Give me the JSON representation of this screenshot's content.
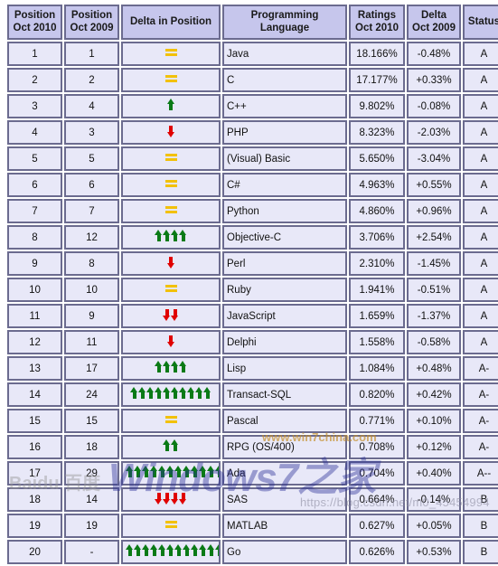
{
  "table": {
    "columns": [
      {
        "key": "pos2010",
        "label_line1": "Position",
        "label_line2": "Oct 2010"
      },
      {
        "key": "pos2009",
        "label_line1": "Position",
        "label_line2": "Oct 2009"
      },
      {
        "key": "delta",
        "label_line1": "Delta in Position",
        "label_line2": ""
      },
      {
        "key": "language",
        "label_line1": "Programming Language",
        "label_line2": ""
      },
      {
        "key": "ratings",
        "label_line1": "Ratings",
        "label_line2": "Oct 2010"
      },
      {
        "key": "deltaratings",
        "label_line1": "Delta",
        "label_line2": "Oct 2009"
      },
      {
        "key": "status",
        "label_line1": "Status",
        "label_line2": ""
      }
    ],
    "rows": [
      {
        "pos2010": "1",
        "pos2009": "1",
        "delta_dir": "equal",
        "delta_count": 1,
        "language": "Java",
        "ratings": "18.166%",
        "deltaratings": "-0.48%",
        "status": "A"
      },
      {
        "pos2010": "2",
        "pos2009": "2",
        "delta_dir": "equal",
        "delta_count": 1,
        "language": "C",
        "ratings": "17.177%",
        "deltaratings": "+0.33%",
        "status": "A"
      },
      {
        "pos2010": "3",
        "pos2009": "4",
        "delta_dir": "up",
        "delta_count": 1,
        "language": "C++",
        "ratings": "9.802%",
        "deltaratings": "-0.08%",
        "status": "A"
      },
      {
        "pos2010": "4",
        "pos2009": "3",
        "delta_dir": "down",
        "delta_count": 1,
        "language": "PHP",
        "ratings": "8.323%",
        "deltaratings": "-2.03%",
        "status": "A"
      },
      {
        "pos2010": "5",
        "pos2009": "5",
        "delta_dir": "equal",
        "delta_count": 1,
        "language": "(Visual) Basic",
        "ratings": "5.650%",
        "deltaratings": "-3.04%",
        "status": "A"
      },
      {
        "pos2010": "6",
        "pos2009": "6",
        "delta_dir": "equal",
        "delta_count": 1,
        "language": "C#",
        "ratings": "4.963%",
        "deltaratings": "+0.55%",
        "status": "A"
      },
      {
        "pos2010": "7",
        "pos2009": "7",
        "delta_dir": "equal",
        "delta_count": 1,
        "language": "Python",
        "ratings": "4.860%",
        "deltaratings": "+0.96%",
        "status": "A"
      },
      {
        "pos2010": "8",
        "pos2009": "12",
        "delta_dir": "up",
        "delta_count": 4,
        "language": "Objective-C",
        "ratings": "3.706%",
        "deltaratings": "+2.54%",
        "status": "A"
      },
      {
        "pos2010": "9",
        "pos2009": "8",
        "delta_dir": "down",
        "delta_count": 1,
        "language": "Perl",
        "ratings": "2.310%",
        "deltaratings": "-1.45%",
        "status": "A"
      },
      {
        "pos2010": "10",
        "pos2009": "10",
        "delta_dir": "equal",
        "delta_count": 1,
        "language": "Ruby",
        "ratings": "1.941%",
        "deltaratings": "-0.51%",
        "status": "A"
      },
      {
        "pos2010": "11",
        "pos2009": "9",
        "delta_dir": "down",
        "delta_count": 2,
        "language": "JavaScript",
        "ratings": "1.659%",
        "deltaratings": "-1.37%",
        "status": "A"
      },
      {
        "pos2010": "12",
        "pos2009": "11",
        "delta_dir": "down",
        "delta_count": 1,
        "language": "Delphi",
        "ratings": "1.558%",
        "deltaratings": "-0.58%",
        "status": "A"
      },
      {
        "pos2010": "13",
        "pos2009": "17",
        "delta_dir": "up",
        "delta_count": 4,
        "language": "Lisp",
        "ratings": "1.084%",
        "deltaratings": "+0.48%",
        "status": "A-"
      },
      {
        "pos2010": "14",
        "pos2009": "24",
        "delta_dir": "up",
        "delta_count": 10,
        "language": "Transact-SQL",
        "ratings": "0.820%",
        "deltaratings": "+0.42%",
        "status": "A-"
      },
      {
        "pos2010": "15",
        "pos2009": "15",
        "delta_dir": "equal",
        "delta_count": 1,
        "language": "Pascal",
        "ratings": "0.771%",
        "deltaratings": "+0.10%",
        "status": "A-"
      },
      {
        "pos2010": "16",
        "pos2009": "18",
        "delta_dir": "up",
        "delta_count": 2,
        "language": "RPG (OS/400)",
        "ratings": "0.708%",
        "deltaratings": "+0.12%",
        "status": "A-"
      },
      {
        "pos2010": "17",
        "pos2009": "29",
        "delta_dir": "up",
        "delta_count": 12,
        "language": "Ada",
        "ratings": "0.704%",
        "deltaratings": "+0.40%",
        "status": "A--"
      },
      {
        "pos2010": "18",
        "pos2009": "14",
        "delta_dir": "down",
        "delta_count": 4,
        "language": "SAS",
        "ratings": "0.664%",
        "deltaratings": "-0.14%",
        "status": "B"
      },
      {
        "pos2010": "19",
        "pos2009": "19",
        "delta_dir": "equal",
        "delta_count": 1,
        "language": "MATLAB",
        "ratings": "0.627%",
        "deltaratings": "+0.05%",
        "status": "B"
      },
      {
        "pos2010": "20",
        "pos2009": "-",
        "delta_dir": "up",
        "delta_count": 12,
        "language": "Go",
        "ratings": "0.626%",
        "deltaratings": "+0.53%",
        "status": "B"
      }
    ]
  },
  "watermarks": {
    "windows7": "Windows7之家",
    "win7china": "www.win7china.com",
    "baidu": "Baidu 百度",
    "csdn": "https://blog.csdn.net/m0_45454994"
  },
  "colors": {
    "header_bg": "#c6c6ec",
    "row_bg": "#e8e8f8",
    "border": "#6b6b8f",
    "link": "#2b2bbb",
    "arrow_up": "#0a7a16",
    "arrow_down": "#e00000",
    "equal": "#f2c10a"
  }
}
